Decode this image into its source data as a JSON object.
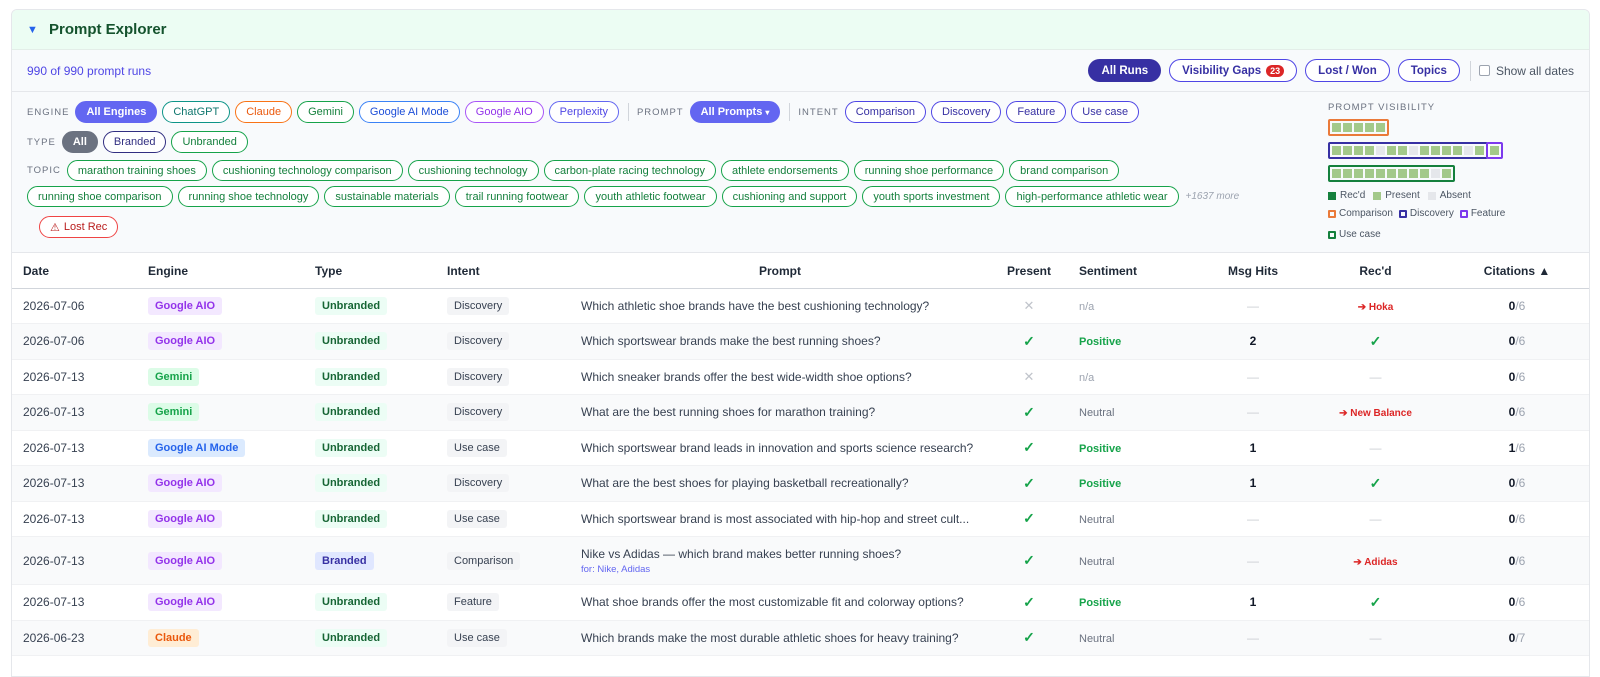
{
  "header": {
    "title": "Prompt Explorer",
    "caret": "▼"
  },
  "toolbar": {
    "runs_count": "990 of 990 prompt runs",
    "buttons": [
      {
        "label": "All Runs",
        "active": true
      },
      {
        "label": "Visibility Gaps",
        "badge": "23"
      },
      {
        "label": "Lost / Won"
      },
      {
        "label": "Topics"
      }
    ],
    "show_all_dates": "Show all dates"
  },
  "filters": {
    "engine_label": "ENGINE",
    "engines": [
      "All Engines",
      "ChatGPT",
      "Claude",
      "Gemini",
      "Google AI Mode",
      "Google AIO",
      "Perplexity"
    ],
    "prompt_label": "PROMPT",
    "prompt_selected": "All Prompts",
    "prompt_caret": "▾",
    "intent_label": "INTENT",
    "intents": [
      "Comparison",
      "Discovery",
      "Feature",
      "Use case"
    ],
    "type_label": "TYPE",
    "types": [
      "All",
      "Branded",
      "Unbranded"
    ],
    "topic_label": "TOPIC",
    "topics_row1": [
      "marathon training shoes",
      "cushioning technology comparison",
      "cushioning technology",
      "carbon-plate racing technology",
      "athlete endorsements",
      "running shoe performance",
      "brand comparison"
    ],
    "topics_row2": [
      "running shoe comparison",
      "running shoe technology",
      "sustainable materials",
      "trail running footwear",
      "youth athletic footwear",
      "cushioning and support",
      "youth sports investment",
      "high-performance athletic wear"
    ],
    "more": "+1637 more",
    "lost_rec": "Lost Rec",
    "lost_rec_icon": "⚠"
  },
  "visibility": {
    "title": "PROMPT VISIBILITY",
    "legend": {
      "recd": "Rec'd",
      "present": "Present",
      "absent": "Absent",
      "comparison": "Comparison",
      "discovery": "Discovery",
      "feature": "Feature",
      "use_case": "Use case"
    },
    "colors": {
      "recd": "#15803d",
      "present": "#a3c98a",
      "absent": "#e5e7eb",
      "comparison": "#ea7a3a",
      "discovery": "#3730a3",
      "feature": "#7c3aed",
      "use_case": "#15803d"
    }
  },
  "table": {
    "headers": {
      "date": "Date",
      "engine": "Engine",
      "type": "Type",
      "intent": "Intent",
      "prompt": "Prompt",
      "present": "Present",
      "sentiment": "Sentiment",
      "hits": "Msg Hits",
      "recd": "Rec'd",
      "citations": "Citations ▲"
    },
    "rows": [
      {
        "date": "2026-07-06",
        "engine": "Google AIO",
        "type": "Unbranded",
        "intent": "Discovery",
        "prompt": "Which athletic shoe brands have the best cushioning technology?",
        "present": "✕",
        "sentiment": "n/a",
        "hits": "—",
        "recd": "➔ Hoka",
        "cite_n": "0",
        "cite_d": "/6"
      },
      {
        "date": "2026-07-06",
        "engine": "Google AIO",
        "type": "Unbranded",
        "intent": "Discovery",
        "prompt": "Which sportswear brands make the best running shoes?",
        "present": "✓",
        "sentiment": "Positive",
        "hits": "2",
        "recd": "✓",
        "cite_n": "0",
        "cite_d": "/6"
      },
      {
        "date": "2026-07-13",
        "engine": "Gemini",
        "type": "Unbranded",
        "intent": "Discovery",
        "prompt": "Which sneaker brands offer the best wide-width shoe options?",
        "present": "✕",
        "sentiment": "n/a",
        "hits": "—",
        "recd": "—",
        "cite_n": "0",
        "cite_d": "/6"
      },
      {
        "date": "2026-07-13",
        "engine": "Gemini",
        "type": "Unbranded",
        "intent": "Discovery",
        "prompt": "What are the best running shoes for marathon training?",
        "present": "✓",
        "sentiment": "Neutral",
        "hits": "—",
        "recd": "➔ New Balance",
        "cite_n": "0",
        "cite_d": "/6"
      },
      {
        "date": "2026-07-13",
        "engine": "Google AI Mode",
        "type": "Unbranded",
        "intent": "Use case",
        "prompt": "Which sportswear brand leads in innovation and sports science research?",
        "present": "✓",
        "sentiment": "Positive",
        "hits": "1",
        "recd": "—",
        "cite_n": "1",
        "cite_d": "/6"
      },
      {
        "date": "2026-07-13",
        "engine": "Google AIO",
        "type": "Unbranded",
        "intent": "Discovery",
        "prompt": "What are the best shoes for playing basketball recreationally?",
        "present": "✓",
        "sentiment": "Positive",
        "hits": "1",
        "recd": "✓",
        "cite_n": "0",
        "cite_d": "/6"
      },
      {
        "date": "2026-07-13",
        "engine": "Google AIO",
        "type": "Unbranded",
        "intent": "Use case",
        "prompt": "Which sportswear brand is most associated with hip-hop and street cult...",
        "present": "✓",
        "sentiment": "Neutral",
        "hits": "—",
        "recd": "—",
        "cite_n": "0",
        "cite_d": "/6"
      },
      {
        "date": "2026-07-13",
        "engine": "Google AIO",
        "type": "Branded",
        "intent": "Comparison",
        "prompt": "Nike vs Adidas — which brand makes better running shoes?",
        "prompt_sub": "for: Nike, Adidas",
        "present": "✓",
        "sentiment": "Neutral",
        "hits": "—",
        "recd": "➔ Adidas",
        "cite_n": "0",
        "cite_d": "/6"
      },
      {
        "date": "2026-07-13",
        "engine": "Google AIO",
        "type": "Unbranded",
        "intent": "Feature",
        "prompt": "What shoe brands offer the most customizable fit and colorway options?",
        "present": "✓",
        "sentiment": "Positive",
        "hits": "1",
        "recd": "✓",
        "cite_n": "0",
        "cite_d": "/6"
      },
      {
        "date": "2026-06-23",
        "engine": "Claude",
        "type": "Unbranded",
        "intent": "Use case",
        "prompt": "Which brands make the most durable athletic shoes for heavy training?",
        "present": "✓",
        "sentiment": "Neutral",
        "hits": "—",
        "recd": "—",
        "cite_n": "0",
        "cite_d": "/7"
      }
    ]
  }
}
